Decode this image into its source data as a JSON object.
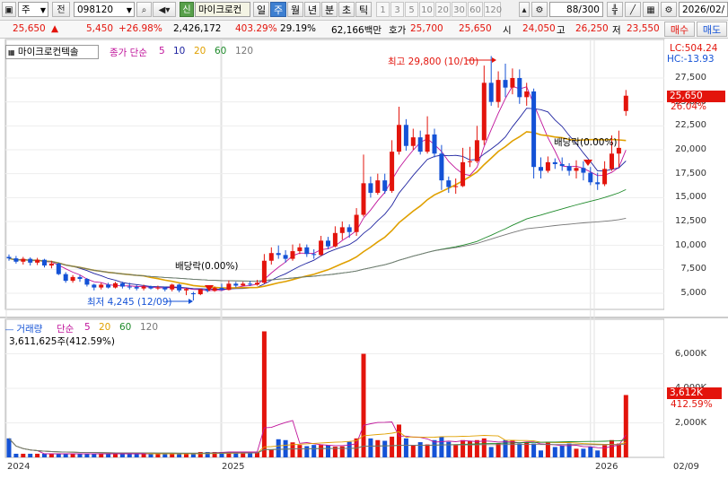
{
  "toolbar": {
    "market": "주",
    "board": "전",
    "code": "098120",
    "badge": "신",
    "stock_name": "마이크로컨",
    "periods": [
      {
        "label": "일",
        "active": false
      },
      {
        "label": "주",
        "active": true
      },
      {
        "label": "월",
        "active": false
      },
      {
        "label": "년",
        "active": false
      },
      {
        "label": "분",
        "active": false
      },
      {
        "label": "초",
        "active": false
      },
      {
        "label": "틱",
        "active": false
      }
    ],
    "intervals": [
      "1",
      "3",
      "5",
      "10",
      "20",
      "30",
      "60",
      "120"
    ],
    "count": "88",
    "total": "/300",
    "date": "2026/02/"
  },
  "quote": {
    "price": "25,650",
    "direction": "▲",
    "change": "5,450",
    "change_pct": "+26.98%",
    "volume": "2,426,172",
    "volume_ratio": "403.29%",
    "turnover": "29.19%",
    "amount": "62,166백만",
    "bid_label": "호가",
    "bid1": "25,700",
    "bid2": "25,650",
    "open_label": "시",
    "open": "24,050",
    "high_label": "고",
    "high": "26,250",
    "low_label": "저",
    "low": "23,550",
    "buy": "매수",
    "sell": "매도"
  },
  "price_panel": {
    "title": "마이크로컨텍솔",
    "ma_title": "종가 단순",
    "ma_periods": [
      "5",
      "10",
      "20",
      "60",
      "120"
    ],
    "lc": "LC:504.24",
    "hc": "HC:-13.93",
    "y_ticks": [
      "27,500",
      "25,000",
      "22,500",
      "20,000",
      "17,500",
      "15,000",
      "12,500",
      "10,000",
      "7,500",
      "5,000"
    ],
    "current_price": "25,650",
    "current_pct": "26.04%",
    "high_note": "최고 29,800 (10/10)",
    "low_note": "최저 4,245 (12/09)",
    "dividend_1": "배당락(0.00%)",
    "dividend_2": "배당락(0.00%)"
  },
  "volume_panel": {
    "title": "거래량",
    "ma_title": "단순",
    "ma_periods": [
      "5",
      "20",
      "60",
      "120"
    ],
    "volume_text": "3,611,625주(412.59%)",
    "y_ticks": [
      "6,000K",
      "4,000K",
      "2,000K"
    ],
    "current": "3,612K",
    "current_pct": "412.59%"
  },
  "x_axis": {
    "labels": [
      "2024",
      "2025",
      "2026"
    ],
    "end_label": "02/09"
  },
  "chart_data": {
    "type": "candlestick",
    "timeframe": "weekly",
    "candles": [
      {
        "o": 8800,
        "c": 8650,
        "h": 9050,
        "l": 8400
      },
      {
        "o": 8650,
        "c": 8300,
        "h": 8900,
        "l": 8100
      },
      {
        "o": 8300,
        "c": 8600,
        "h": 8800,
        "l": 8000
      },
      {
        "o": 8600,
        "c": 8200,
        "h": 8750,
        "l": 7900
      },
      {
        "o": 8200,
        "c": 8500,
        "h": 8700,
        "l": 7950
      },
      {
        "o": 8500,
        "c": 7900,
        "h": 8600,
        "l": 7700
      },
      {
        "o": 7900,
        "c": 8100,
        "h": 8400,
        "l": 7600
      },
      {
        "o": 8100,
        "c": 7000,
        "h": 8200,
        "l": 6900
      },
      {
        "o": 7000,
        "c": 6300,
        "h": 7200,
        "l": 6100
      },
      {
        "o": 6300,
        "c": 6700,
        "h": 6900,
        "l": 6100
      },
      {
        "o": 6700,
        "c": 6500,
        "h": 6900,
        "l": 6200
      },
      {
        "o": 6500,
        "c": 5900,
        "h": 6600,
        "l": 5700
      },
      {
        "o": 5900,
        "c": 5600,
        "h": 6000,
        "l": 5300
      },
      {
        "o": 5600,
        "c": 5900,
        "h": 6100,
        "l": 5400
      },
      {
        "o": 5900,
        "c": 5600,
        "h": 6100,
        "l": 5500
      },
      {
        "o": 5600,
        "c": 6050,
        "h": 6200,
        "l": 5500
      },
      {
        "o": 6050,
        "c": 5700,
        "h": 6200,
        "l": 5500
      },
      {
        "o": 5700,
        "c": 5650,
        "h": 6100,
        "l": 5400
      },
      {
        "o": 5650,
        "c": 5500,
        "h": 5900,
        "l": 5300
      },
      {
        "o": 5500,
        "c": 5700,
        "h": 5900,
        "l": 5300
      },
      {
        "o": 5700,
        "c": 5500,
        "h": 5800,
        "l": 5400
      },
      {
        "o": 5500,
        "c": 5600,
        "h": 5800,
        "l": 5350
      },
      {
        "o": 5600,
        "c": 5400,
        "h": 5700,
        "l": 5200
      },
      {
        "o": 5400,
        "c": 5900,
        "h": 6000,
        "l": 5200
      },
      {
        "o": 5900,
        "c": 5300,
        "h": 6000,
        "l": 5100
      },
      {
        "o": 5300,
        "c": 5450,
        "h": 5550,
        "l": 4800
      },
      {
        "o": 5000,
        "c": 4900,
        "h": 5150,
        "l": 4245
      },
      {
        "o": 4900,
        "c": 5400,
        "h": 5500,
        "l": 4800
      },
      {
        "o": 5400,
        "c": 5250,
        "h": 5600,
        "l": 5100
      },
      {
        "o": 5250,
        "c": 5550,
        "h": 5700,
        "l": 5150
      },
      {
        "o": 5550,
        "c": 5350,
        "h": 6000,
        "l": 5250
      },
      {
        "o": 5350,
        "c": 6000,
        "h": 6350,
        "l": 5300
      },
      {
        "o": 6000,
        "c": 5800,
        "h": 6200,
        "l": 5600
      },
      {
        "o": 5800,
        "c": 6000,
        "h": 6200,
        "l": 5700
      },
      {
        "o": 6000,
        "c": 5900,
        "h": 6300,
        "l": 5750
      },
      {
        "o": 5900,
        "c": 6100,
        "h": 6400,
        "l": 5800
      },
      {
        "o": 6100,
        "c": 8400,
        "h": 9100,
        "l": 6000
      },
      {
        "o": 8400,
        "c": 9200,
        "h": 9800,
        "l": 8000
      },
      {
        "o": 9200,
        "c": 9000,
        "h": 10000,
        "l": 8600
      },
      {
        "o": 9000,
        "c": 8600,
        "h": 9500,
        "l": 8200
      },
      {
        "o": 8600,
        "c": 9400,
        "h": 10100,
        "l": 8400
      },
      {
        "o": 9400,
        "c": 9800,
        "h": 10200,
        "l": 9100
      },
      {
        "o": 9800,
        "c": 9100,
        "h": 10100,
        "l": 8800
      },
      {
        "o": 9100,
        "c": 9000,
        "h": 9600,
        "l": 8600
      },
      {
        "o": 9000,
        "c": 10500,
        "h": 11000,
        "l": 8900
      },
      {
        "o": 10500,
        "c": 9900,
        "h": 10900,
        "l": 9600
      },
      {
        "o": 9900,
        "c": 11300,
        "h": 12000,
        "l": 9800
      },
      {
        "o": 11300,
        "c": 11900,
        "h": 12500,
        "l": 10600
      },
      {
        "o": 11900,
        "c": 11400,
        "h": 12200,
        "l": 10800
      },
      {
        "o": 11400,
        "c": 13200,
        "h": 13900,
        "l": 11000
      },
      {
        "o": 13200,
        "c": 16500,
        "h": 19500,
        "l": 13000
      },
      {
        "o": 16500,
        "c": 15500,
        "h": 17200,
        "l": 15000
      },
      {
        "o": 15500,
        "c": 16800,
        "h": 17500,
        "l": 15300
      },
      {
        "o": 16800,
        "c": 15700,
        "h": 17500,
        "l": 15400
      },
      {
        "o": 15700,
        "c": 19800,
        "h": 21000,
        "l": 15500
      },
      {
        "o": 19800,
        "c": 22600,
        "h": 24500,
        "l": 19500
      },
      {
        "o": 22600,
        "c": 20400,
        "h": 23200,
        "l": 19900
      },
      {
        "o": 20400,
        "c": 21300,
        "h": 22200,
        "l": 20000
      },
      {
        "o": 21300,
        "c": 19800,
        "h": 22000,
        "l": 19500
      },
      {
        "o": 19800,
        "c": 21600,
        "h": 23500,
        "l": 19600
      },
      {
        "o": 21600,
        "c": 19600,
        "h": 22200,
        "l": 19200
      },
      {
        "o": 19600,
        "c": 16800,
        "h": 20500,
        "l": 15800
      },
      {
        "o": 16800,
        "c": 16100,
        "h": 17200,
        "l": 15500
      },
      {
        "o": 16100,
        "c": 16200,
        "h": 17000,
        "l": 15400
      },
      {
        "o": 16200,
        "c": 18700,
        "h": 20200,
        "l": 16100
      },
      {
        "o": 18700,
        "c": 18800,
        "h": 20300,
        "l": 18200
      },
      {
        "o": 18800,
        "c": 21000,
        "h": 22500,
        "l": 18600
      },
      {
        "o": 21000,
        "c": 27000,
        "h": 28800,
        "l": 20500
      },
      {
        "o": 27000,
        "c": 25000,
        "h": 29800,
        "l": 24600
      },
      {
        "o": 25000,
        "c": 27300,
        "h": 28200,
        "l": 24400
      },
      {
        "o": 27300,
        "c": 26500,
        "h": 29000,
        "l": 25500
      },
      {
        "o": 26500,
        "c": 27500,
        "h": 28500,
        "l": 25800
      },
      {
        "o": 27500,
        "c": 25500,
        "h": 28400,
        "l": 24800
      },
      {
        "o": 25500,
        "c": 26100,
        "h": 27000,
        "l": 24600
      },
      {
        "o": 26100,
        "c": 18200,
        "h": 26400,
        "l": 17000
      },
      {
        "o": 18200,
        "c": 17800,
        "h": 19200,
        "l": 17000
      },
      {
        "o": 17800,
        "c": 18700,
        "h": 19300,
        "l": 17600
      },
      {
        "o": 18700,
        "c": 18500,
        "h": 19100,
        "l": 18000
      },
      {
        "o": 18500,
        "c": 18300,
        "h": 19200,
        "l": 17800
      },
      {
        "o": 18300,
        "c": 17800,
        "h": 18600,
        "l": 17300
      },
      {
        "o": 17800,
        "c": 18100,
        "h": 18900,
        "l": 17000
      },
      {
        "o": 18100,
        "c": 17600,
        "h": 18800,
        "l": 16800
      },
      {
        "o": 17600,
        "c": 16600,
        "h": 18200,
        "l": 16300
      },
      {
        "o": 16600,
        "c": 16400,
        "h": 17600,
        "l": 15800
      },
      {
        "o": 16400,
        "c": 18000,
        "h": 18800,
        "l": 16200
      },
      {
        "o": 18000,
        "c": 19600,
        "h": 21500,
        "l": 17800
      },
      {
        "o": 19600,
        "c": 20200,
        "h": 22000,
        "l": 18200
      },
      {
        "o": 24050,
        "c": 25650,
        "h": 26250,
        "l": 23550
      }
    ],
    "volumes_k": [
      1100,
      210,
      210,
      210,
      210,
      210,
      210,
      210,
      210,
      210,
      210,
      210,
      210,
      210,
      210,
      210,
      210,
      210,
      210,
      210,
      210,
      210,
      210,
      210,
      210,
      210,
      210,
      310,
      310,
      310,
      310,
      310,
      310,
      310,
      310,
      310,
      7300,
      450,
      1050,
      1000,
      870,
      720,
      650,
      720,
      720,
      700,
      620,
      640,
      900,
      1100,
      6000,
      1100,
      1000,
      960,
      1200,
      1900,
      1100,
      720,
      880,
      750,
      1000,
      1200,
      900,
      700,
      1000,
      950,
      1000,
      1100,
      600,
      800,
      1000,
      1000,
      800,
      900,
      800,
      400,
      900,
      600,
      700,
      800,
      500,
      500,
      600,
      400,
      700,
      1000,
      800,
      3612
    ],
    "price_ylim": [
      4245,
      29800
    ],
    "volume_ylim": [
      0,
      7300
    ]
  }
}
